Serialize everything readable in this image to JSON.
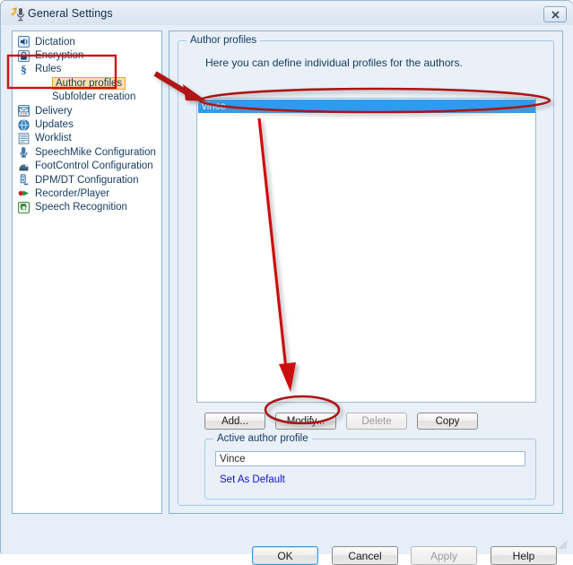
{
  "window": {
    "title": "General Settings",
    "title_icon": "microphone-icon",
    "close_label": "✕"
  },
  "sidebar": {
    "items": [
      {
        "label": "Dictation",
        "icon": "speaker-icon",
        "level": 0,
        "selected": false
      },
      {
        "label": "Encryption",
        "icon": "lock-icon",
        "level": 0,
        "selected": false
      },
      {
        "label": "Rules",
        "icon": "section-sign-icon",
        "level": 0,
        "selected": false
      },
      {
        "label": "Author profiles",
        "icon": "",
        "level": 1,
        "selected": true
      },
      {
        "label": "Subfolder creation",
        "icon": "",
        "level": 1,
        "selected": false
      },
      {
        "label": "Delivery",
        "icon": "ftp-icon",
        "level": 0,
        "selected": false
      },
      {
        "label": "Updates",
        "icon": "globe-icon",
        "level": 0,
        "selected": false
      },
      {
        "label": "Worklist",
        "icon": "list-icon",
        "level": 0,
        "selected": false
      },
      {
        "label": "SpeechMike Configuration",
        "icon": "speechmike-icon",
        "level": 0,
        "selected": false
      },
      {
        "label": "FootControl Configuration",
        "icon": "footcontrol-icon",
        "level": 0,
        "selected": false
      },
      {
        "label": "DPM/DT Configuration",
        "icon": "dpm-icon",
        "level": 0,
        "selected": false
      },
      {
        "label": "Recorder/Player",
        "icon": "play-icon",
        "level": 0,
        "selected": false
      },
      {
        "label": "Speech Recognition",
        "icon": "gear-icon",
        "level": 0,
        "selected": false
      }
    ]
  },
  "main": {
    "group_title": "Author profiles",
    "description": "Here you can define individual profiles for the authors.",
    "list": {
      "items": [
        "vince"
      ],
      "selected_index": 0
    },
    "buttons": {
      "add": "Add...",
      "modify": "Modify...",
      "delete": "Delete",
      "copy": "Copy"
    },
    "active_profile": {
      "group_title": "Active author profile",
      "value": "Vince",
      "link": "Set As Default"
    }
  },
  "dialog_buttons": {
    "ok": "OK",
    "cancel": "Cancel",
    "apply": "Apply",
    "help": "Help"
  },
  "colors": {
    "selection_blue": "#2e9bf0",
    "annotation_red": "#cc1111",
    "highlight_orange": "#ffe2a8",
    "link_blue": "#1414c8",
    "panel_blue": "#e9f0f8"
  }
}
